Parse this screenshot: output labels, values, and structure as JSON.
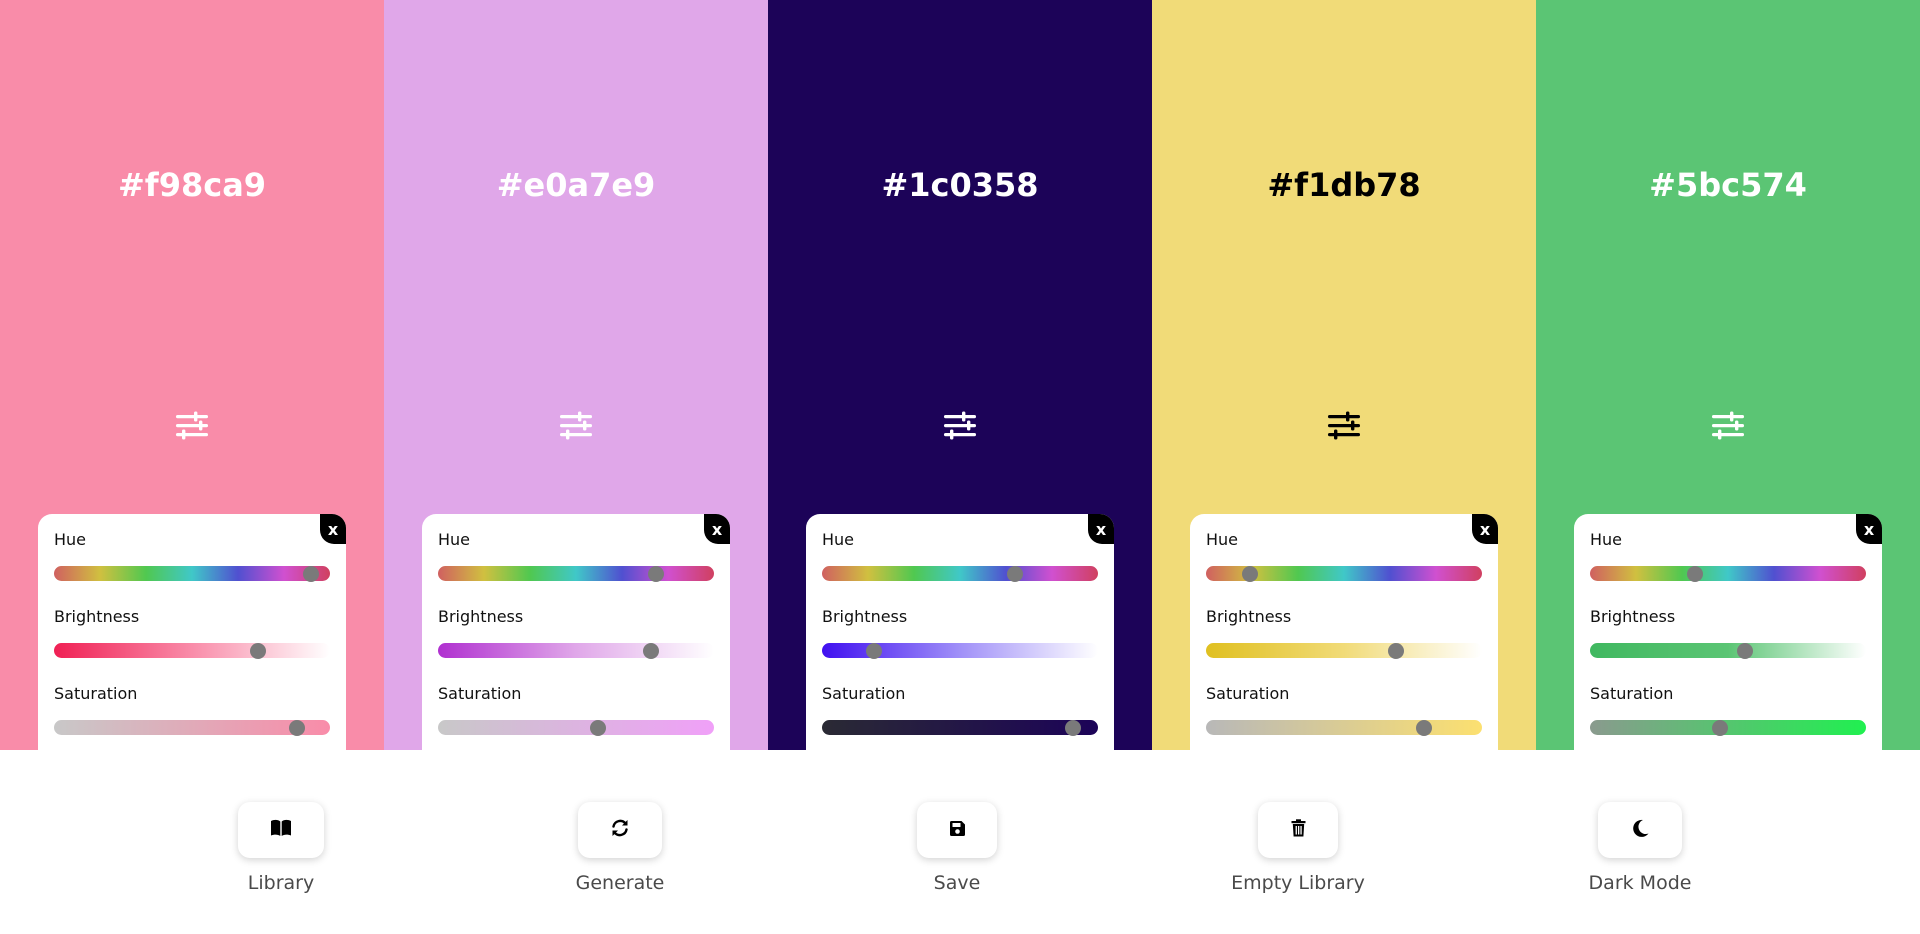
{
  "palette": {
    "columns": [
      {
        "hex": "#f98ca9",
        "text_color": "#ffffff",
        "icon_color": "#ffffff",
        "panel": {
          "close_label": "x",
          "sliders": [
            {
              "label": "Hue",
              "gradient": [
                "#d06060",
                "#d0c040",
                "#50c850",
                "#40c8c8",
                "#5050d0",
                "#d050d0",
                "#d04060"
              ],
              "value": 0.93
            },
            {
              "label": "Brightness",
              "gradient": [
                "#f02054",
                "#f98ca9",
                "#ffffff"
              ],
              "value": 0.74
            },
            {
              "label": "Saturation",
              "gradient": [
                "#c8c8c8",
                "#f98ca9"
              ],
              "value": 0.88
            }
          ]
        }
      },
      {
        "hex": "#e0a7e9",
        "text_color": "#ffffff",
        "icon_color": "#ffffff",
        "panel": {
          "close_label": "x",
          "sliders": [
            {
              "label": "Hue",
              "gradient": [
                "#d06060",
                "#d0c040",
                "#50c850",
                "#40c8c8",
                "#5050d0",
                "#d050d0",
                "#d04060"
              ],
              "value": 0.79
            },
            {
              "label": "Brightness",
              "gradient": [
                "#b030d0",
                "#e0a7e9",
                "#ffffff"
              ],
              "value": 0.77
            },
            {
              "label": "Saturation",
              "gradient": [
                "#c8c8c8",
                "#f0a0f8"
              ],
              "value": 0.58
            }
          ]
        }
      },
      {
        "hex": "#1c0358",
        "text_color": "#ffffff",
        "icon_color": "#ffffff",
        "panel": {
          "close_label": "x",
          "sliders": [
            {
              "label": "Hue",
              "gradient": [
                "#d06060",
                "#d0c040",
                "#50c850",
                "#40c8c8",
                "#5050d0",
                "#d050d0",
                "#d04060"
              ],
              "value": 0.7
            },
            {
              "label": "Brightness",
              "gradient": [
                "#4010f0",
                "#a090f8",
                "#ffffff"
              ],
              "value": 0.19
            },
            {
              "label": "Saturation",
              "gradient": [
                "#2a2a34",
                "#1c0358"
              ],
              "value": 0.91
            }
          ]
        }
      },
      {
        "hex": "#f1db78",
        "text_color": "#000000",
        "icon_color": "#000000",
        "panel": {
          "close_label": "x",
          "sliders": [
            {
              "label": "Hue",
              "gradient": [
                "#d06060",
                "#d0c040",
                "#50c850",
                "#40c8c8",
                "#5050d0",
                "#d050d0",
                "#d04060"
              ],
              "value": 0.16
            },
            {
              "label": "Brightness",
              "gradient": [
                "#e0c020",
                "#f1db78",
                "#ffffff"
              ],
              "value": 0.69
            },
            {
              "label": "Saturation",
              "gradient": [
                "#b8b8b8",
                "#fce070"
              ],
              "value": 0.79
            }
          ]
        }
      },
      {
        "hex": "#5bc574",
        "text_color": "#ffffff",
        "icon_color": "#ffffff",
        "panel": {
          "close_label": "x",
          "sliders": [
            {
              "label": "Hue",
              "gradient": [
                "#d06060",
                "#d0c040",
                "#50c850",
                "#40c8c8",
                "#5050d0",
                "#d050d0",
                "#d04060"
              ],
              "value": 0.38
            },
            {
              "label": "Brightness",
              "gradient": [
                "#40b860",
                "#5bc574",
                "#ffffff"
              ],
              "value": 0.56
            },
            {
              "label": "Saturation",
              "gradient": [
                "#8a9a8e",
                "#20f050"
              ],
              "value": 0.47
            }
          ]
        }
      }
    ]
  },
  "toolbar": {
    "items": [
      {
        "name": "library",
        "label": "Library",
        "icon": "book-open-icon"
      },
      {
        "name": "generate",
        "label": "Generate",
        "icon": "refresh-icon"
      },
      {
        "name": "save",
        "label": "Save",
        "icon": "save-icon"
      },
      {
        "name": "empty-library",
        "label": "Empty Library",
        "icon": "trash-icon"
      },
      {
        "name": "dark-mode",
        "label": "Dark Mode",
        "icon": "moon-icon"
      }
    ]
  }
}
